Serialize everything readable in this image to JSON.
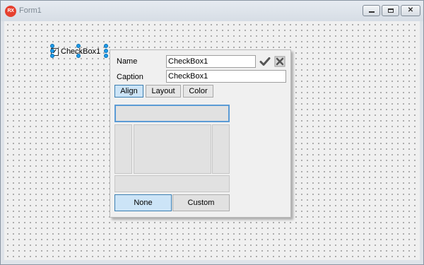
{
  "window": {
    "title": "Form1",
    "app_icon_text": "RX"
  },
  "canvas": {
    "checkbox": {
      "label": "CheckBox1",
      "checked": true
    }
  },
  "inspector": {
    "name_label": "Name",
    "name_value": "CheckBox1",
    "caption_label": "Caption",
    "caption_value": "CheckBox1",
    "tabs": [
      {
        "label": "Align",
        "active": true
      },
      {
        "label": "Layout",
        "active": false
      },
      {
        "label": "Color",
        "active": false
      }
    ],
    "align_none_label": "None",
    "align_custom_label": "Custom",
    "selected_align": "None"
  },
  "colors": {
    "handle": "#1e9bea",
    "active_tab": "#cce4f7",
    "app_icon": "#e6402f"
  },
  "icons": [
    "app-icon",
    "minimize-icon",
    "maximize-icon",
    "close-icon",
    "checkmark-icon",
    "cross-icon"
  ]
}
